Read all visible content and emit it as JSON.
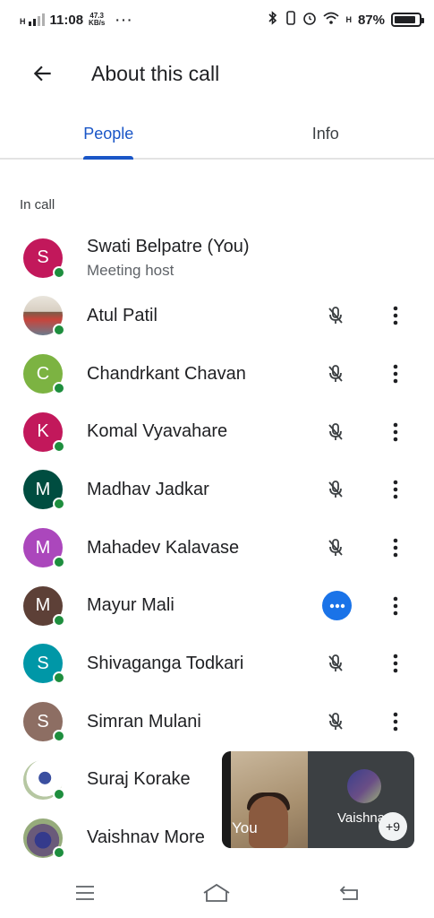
{
  "status_bar": {
    "time": "11:08",
    "network": "H",
    "speed_value": "47.3",
    "speed_unit": "KB/s",
    "overflow": "···",
    "network_right": "H",
    "battery": "87%",
    "battery_level": 0.87
  },
  "header": {
    "back_icon": "arrow-back-icon",
    "title": "About this call"
  },
  "tabs": [
    {
      "label": "People",
      "active": true
    },
    {
      "label": "Info",
      "active": false
    }
  ],
  "section_label": "In call",
  "participants": [
    {
      "name": "Swati Belpatre (You)",
      "subtitle": "Meeting host",
      "initial": "S",
      "color": "#c2185b"
    },
    {
      "name": "Atul Patil",
      "initial": "",
      "color": "photo",
      "mic": "mic-off-icon"
    },
    {
      "name": "Chandrkant Chavan",
      "initial": "C",
      "color": "#7cb342",
      "mic": "mic-off-icon"
    },
    {
      "name": "Komal Vyavahare",
      "initial": "K",
      "color": "#c2185b",
      "mic": "mic-off-icon"
    },
    {
      "name": "Madhav Jadkar",
      "initial": "M",
      "color": "#004d40",
      "mic": "mic-off-icon"
    },
    {
      "name": "Mahadev Kalavase",
      "initial": "M",
      "color": "#ab47bc",
      "mic": "mic-off-icon"
    },
    {
      "name": "Mayur Mali",
      "initial": "M",
      "color": "#5d4037",
      "mic": "speaking-icon"
    },
    {
      "name": "Shivaganga Todkari",
      "initial": "S",
      "color": "#0097a7",
      "mic": "mic-off-icon"
    },
    {
      "name": "Simran Mulani",
      "initial": "S",
      "color": "#8d6e63",
      "mic": "mic-off-icon"
    },
    {
      "name": "Suraj Korake",
      "initial": "",
      "color": "photo"
    },
    {
      "name": "Vaishnav More",
      "initial": "",
      "color": "photo"
    }
  ],
  "pip": {
    "self_label": "You",
    "other_name": "Vaishna",
    "extra_count": "+9"
  },
  "nav": {
    "menu_icon": "menu-icon",
    "home_icon": "home-icon",
    "back_icon": "back-nav-icon"
  },
  "colors": {
    "accent": "#1a56c7",
    "online": "#1e8e3e",
    "speaking": "#1a73e8"
  }
}
